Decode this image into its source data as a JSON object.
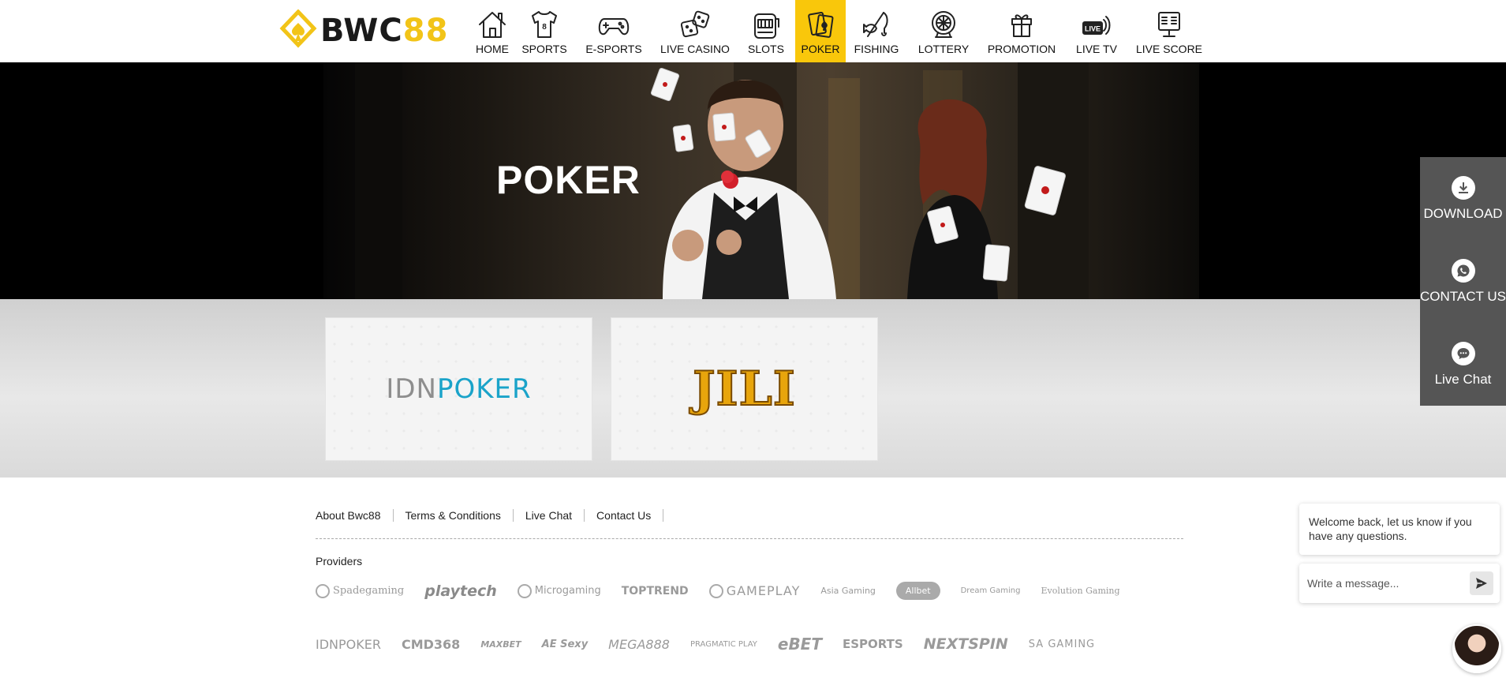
{
  "logo": {
    "text_dark": "BWC",
    "text_gold": "88"
  },
  "nav": [
    {
      "label": "HOME",
      "icon": "house-icon"
    },
    {
      "label": "SPORTS",
      "icon": "jersey-icon"
    },
    {
      "label": "E-SPORTS",
      "icon": "gamepad-icon"
    },
    {
      "label": "LIVE CASINO",
      "icon": "dice-icon"
    },
    {
      "label": "SLOTS",
      "icon": "slot-machine-icon"
    },
    {
      "label": "POKER",
      "icon": "playing-cards-icon",
      "active": true
    },
    {
      "label": "FISHING",
      "icon": "fishing-icon"
    },
    {
      "label": "LOTTERY",
      "icon": "lottery-wheel-icon"
    },
    {
      "label": "PROMOTION",
      "icon": "gift-icon"
    },
    {
      "label": "LIVE TV",
      "icon": "live-tv-icon"
    },
    {
      "label": "LIVE SCORE",
      "icon": "scoreboard-icon"
    }
  ],
  "colors": {
    "accent": "#f9c70b",
    "side_panel": "#555555"
  },
  "banner": {
    "title": "POKER"
  },
  "providers_cards": [
    {
      "name": "IDNPOKER",
      "part_a": "IDN",
      "part_b": "POKER"
    },
    {
      "name": "JILI"
    }
  ],
  "side_panel": [
    {
      "label": "DOWNLOAD",
      "icon": "download-icon"
    },
    {
      "label": "CONTACT US",
      "icon": "whatsapp-icon"
    },
    {
      "label": "Live Chat",
      "icon": "chat-bubble-icon"
    }
  ],
  "footer": {
    "links": [
      "About Bwc88",
      "Terms & Conditions",
      "Live Chat",
      "Contact Us"
    ],
    "providers_title": "Providers",
    "providers_row1": [
      "Spadegaming",
      "playtech",
      "Microgaming",
      "TOPTREND",
      "GAMEPLAY",
      "Asia Gaming",
      "Allbet",
      "Dream Gaming",
      "Evolution Gaming"
    ],
    "providers_row2": [
      "IDNPOKER",
      "CMD368",
      "MAXBET",
      "AE Sexy",
      "MEGA888",
      "PRAGMATIC PLAY",
      "eBET",
      "ESPORTS",
      "NEXTSPIN",
      "SA GAMING"
    ]
  },
  "chat": {
    "welcome": "Welcome back, let us know if you have any questions.",
    "placeholder": "Write a message..."
  }
}
